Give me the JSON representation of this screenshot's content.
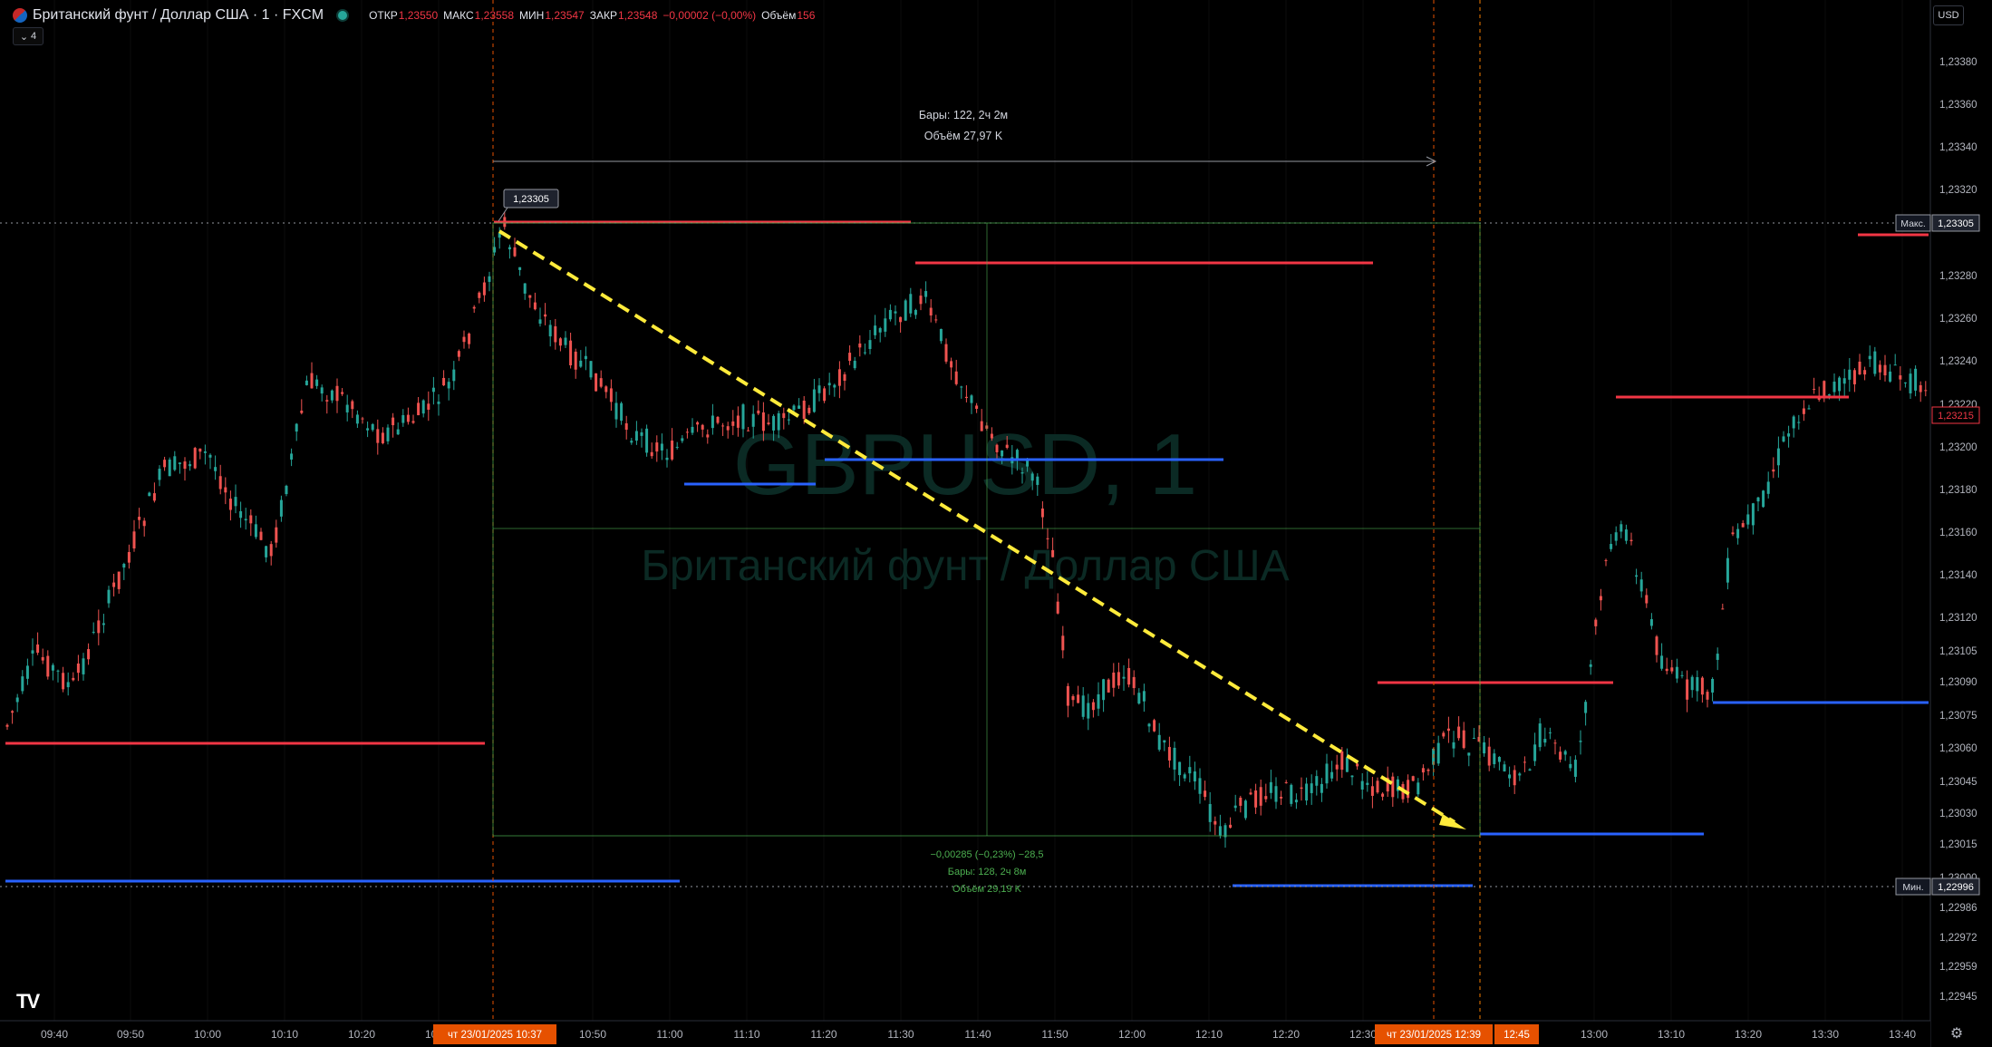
{
  "header": {
    "symbol": "Британский фунт / Доллар США · 1 · FXCM",
    "open_label": "ОТКР",
    "open": "1,23550",
    "high_label": "МАКС",
    "high": "1,23558",
    "low_label": "МИН",
    "low": "1,23547",
    "close_label": "ЗАКР",
    "close": "1,23548",
    "change": "−0,00002 (−0,00%)",
    "volume_label": "Объём",
    "volume": "156",
    "indicator_count": "4",
    "currency": "USD"
  },
  "watermark": {
    "ticker": "GBPUSD, 1",
    "name": "Британский фунт / Доллар США"
  },
  "icons": {
    "settings": "gear-icon",
    "collapse": "chevron-down-icon",
    "logo": "tradingview-logo"
  },
  "colors": {
    "background": "#000000",
    "up": "#26a69a",
    "down": "#ef5350",
    "resistance": "#f23645",
    "support": "#2962ff",
    "trend": "#ffeb3b",
    "measure": "#4caf50",
    "date_badge": "#e65100"
  },
  "chart_data": {
    "type": "candlestick",
    "y_ticks": [
      1.2938,
      1.2936,
      1.2934,
      1.2932,
      1.2928,
      1.2926,
      1.2924,
      1.2922,
      1.292,
      1.2918,
      1.2916,
      1.2914,
      1.2913,
      1.2912,
      1.2909,
      1.29075,
      1.2906,
      1.29045,
      1.2903,
      1.29015,
      1.29,
      1.29986,
      1.29972,
      1.29959,
      1.29945
    ],
    "y_tick_labels": [
      "1,23380",
      "1,23360",
      "1,23340",
      "1,23320",
      "1,23280",
      "1,23260",
      "1,23240",
      "1,23220",
      "1,23200",
      "1,23180",
      "1,23160",
      "1,23140",
      "1,23120",
      "1,23105",
      "1,23090",
      "1,23075",
      "1,23060",
      "1,23045",
      "1,23030",
      "1,23015",
      "1,23000",
      "1,22986",
      "1,22972",
      "1,22959",
      "1,22945"
    ],
    "x_tick_labels": [
      "09:40",
      "09:50",
      "10:00",
      "10:10",
      "10:20",
      "10:30",
      "10:50",
      "11:00",
      "11:10",
      "11:20",
      "11:30",
      "11:40",
      "11:50",
      "12:00",
      "12:10",
      "12:20",
      "12:30",
      "13:00",
      "13:10",
      "13:20",
      "13:30",
      "13:40"
    ],
    "price_tags": [
      {
        "label": "Макс.",
        "value": "1,23305"
      },
      {
        "label": "",
        "value": "1,23215"
      },
      {
        "label": "Мин.",
        "value": "1,22996"
      }
    ],
    "date_badges": [
      {
        "date": "чт 23/01/2025",
        "time": "10:37"
      },
      {
        "date": "чт 23/01/2025",
        "time": "12:39"
      },
      {
        "date": "",
        "time": "12:45"
      }
    ],
    "point_label": "1,23305",
    "measure_top": {
      "bars": "Бары: 122, 2ч 2м",
      "volume": "Объём 27,97 K"
    },
    "measure_bottom": {
      "change": "−0,00285 (−0,23%) −28,5",
      "bars": "Бары: 128, 2ч 8м",
      "volume": "Объём 29,19 K"
    }
  }
}
